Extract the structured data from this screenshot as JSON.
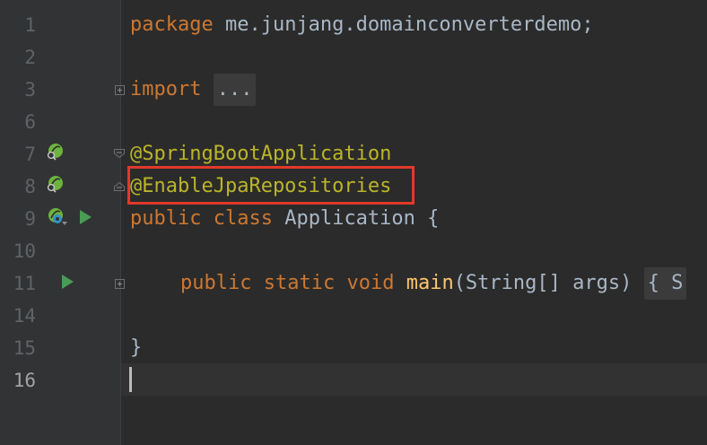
{
  "gutter": {
    "line_numbers": [
      "1",
      "2",
      "3",
      "6",
      "7",
      "8",
      "9",
      "10",
      "11",
      "14",
      "15",
      "16"
    ]
  },
  "code": {
    "line1_package_kw": "package",
    "line1_package_name": " me.junjang.domainconverterdemo;",
    "line3_import_kw": "import",
    "line3_fold": "...",
    "line7_annotation": "@SpringBootApplication",
    "line8_annotation": "@EnableJpaRepositories",
    "line9_public": "public",
    "line9_class": "class",
    "line9_rest": " Application {",
    "line11_public": "public",
    "line11_static": "static",
    "line11_void": "void",
    "line11_main": "main",
    "line11_params": "(String[] args)",
    "line11_fold": "{ S",
    "line15_brace": "}"
  },
  "colors": {
    "keyword": "#cc7832",
    "annotation": "#bbb529",
    "method": "#ffc66d",
    "plain": "#a9b7c6",
    "highlight": "#e0392b"
  }
}
